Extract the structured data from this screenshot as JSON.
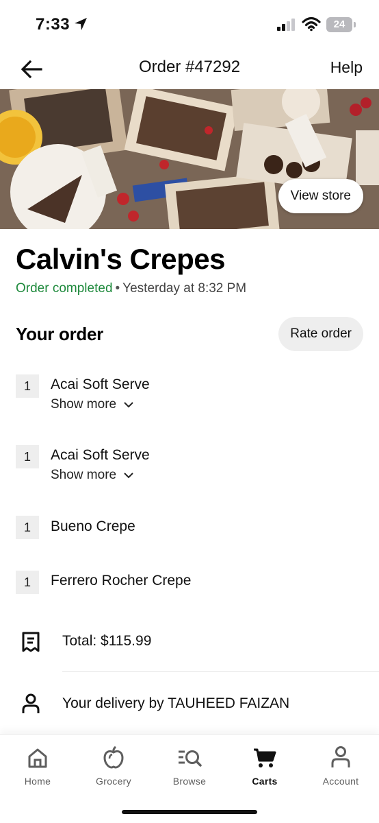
{
  "status_bar": {
    "time": "7:33",
    "battery": "24"
  },
  "header": {
    "title": "Order #47292",
    "help_label": "Help"
  },
  "hero": {
    "view_store_label": "View store"
  },
  "store": {
    "name": "Calvin's Crepes",
    "status": "Order completed",
    "separator": "•",
    "time": "Yesterday at 8:32 PM"
  },
  "order": {
    "title": "Your order",
    "rate_label": "Rate order",
    "items": [
      {
        "qty": "1",
        "name": "Acai Soft Serve",
        "show_more": "Show more"
      },
      {
        "qty": "1",
        "name": "Acai Soft Serve",
        "show_more": "Show more"
      },
      {
        "qty": "1",
        "name": "Bueno Crepe"
      },
      {
        "qty": "1",
        "name": "Ferrero Rocher Crepe"
      }
    ]
  },
  "summary": {
    "total": "Total: $115.99",
    "delivery": "Your delivery by TAUHEED FAIZAN"
  },
  "tabs": [
    {
      "label": "Home",
      "icon": "home-icon"
    },
    {
      "label": "Grocery",
      "icon": "apple-icon"
    },
    {
      "label": "Browse",
      "icon": "browse-icon"
    },
    {
      "label": "Carts",
      "icon": "cart-icon",
      "active": true
    },
    {
      "label": "Account",
      "icon": "account-icon"
    }
  ],
  "colors": {
    "completed_green": "#1f8a3d",
    "pill_gray": "#eeeeee"
  }
}
